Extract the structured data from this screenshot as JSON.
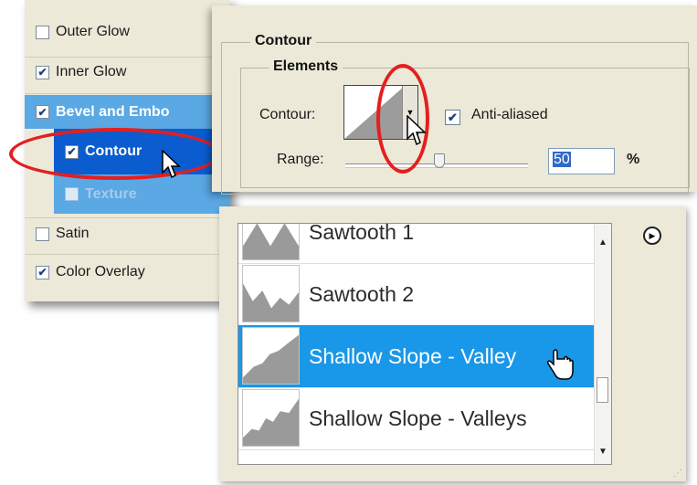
{
  "layer_styles": {
    "items": [
      {
        "label": "Outer Glow",
        "checked": false
      },
      {
        "label": "Inner Glow",
        "checked": true
      },
      {
        "label": "Bevel and Embo",
        "checked": true
      },
      {
        "label": "Contour",
        "checked": true
      },
      {
        "label": "Texture",
        "checked": false
      },
      {
        "label": "Satin",
        "checked": false
      },
      {
        "label": "Color Overlay",
        "checked": true
      }
    ]
  },
  "contour_panel": {
    "group_title": "Contour",
    "elements_title": "Elements",
    "contour_label": "Contour:",
    "anti_aliased_label": "Anti-aliased",
    "anti_aliased_checked": true,
    "range_label": "Range:",
    "range_value": "50",
    "range_unit": "%"
  },
  "contour_picker": {
    "items": [
      {
        "name": "Sawtooth 1",
        "icon": "sawtooth-1-curve"
      },
      {
        "name": "Sawtooth 2",
        "icon": "sawtooth-2-curve"
      },
      {
        "name": "Shallow Slope - Valley",
        "icon": "shallow-slope-valley-curve",
        "selected": true
      },
      {
        "name": "Shallow Slope - Valleys",
        "icon": "shallow-slope-valleys-curve"
      }
    ]
  },
  "colors": {
    "panel_bg": "#ece9d8",
    "selection_blue": "#1997e8",
    "highlight_oval": "#e41f1f"
  }
}
